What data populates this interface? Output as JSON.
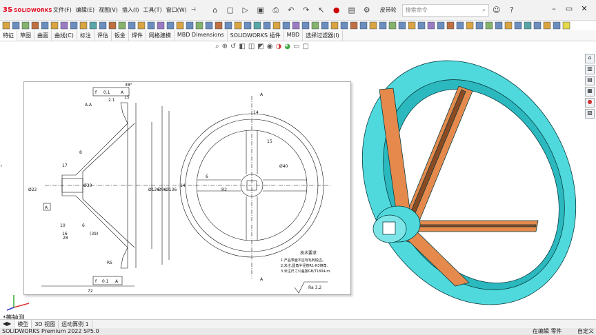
{
  "app": {
    "brand": "SOLIDWORKS",
    "ds_mark": "3S",
    "menus": [
      "文件(F)",
      "编辑(E)",
      "视图(V)",
      "插入(I)",
      "工具(T)",
      "窗口(W)"
    ],
    "pin": "⊣",
    "quick_label": "皮带轮",
    "search_placeholder": "搜索命令"
  },
  "command_tabs": [
    "特征",
    "草图",
    "曲面",
    "曲线(C)",
    "标注",
    "评估",
    "钣金",
    "焊件",
    "网格建模",
    "MBD Dimensions",
    "SOLIDWORKS 插件",
    "MBD",
    "选择过滤器(I)"
  ],
  "drawing": {
    "section_label": "A-A",
    "tolerance_frame": [
      "f",
      "0.1",
      "A"
    ],
    "datum": "A",
    "dims": {
      "d38": "38°",
      "d15": "15",
      "d21": "2.1",
      "d17": "17",
      "d8": "8",
      "d10": "10",
      "d6": "6",
      "d16": "16",
      "d28": "28",
      "d39": "(39)",
      "dR5": "R5",
      "d72": "72",
      "d22": "Ø22",
      "d30": "Ø30",
      "d96": "Ø96",
      "d136": "Ø136",
      "d126": "Ø126",
      "d40": "Ø40",
      "d14": "14",
      "d15b": "15",
      "d6b": "6",
      "d1": "14",
      "dR2": "R2",
      "roughness": "Ra 3.2"
    },
    "notes": [
      "技术要求",
      "1.产品表面不应有毛刺锐边。",
      "2.未注,圆角半径按R1-R3倒角.",
      "3.未注尺寸公差按GB/T1804-m."
    ]
  },
  "view_label": "*等轴测",
  "model_tabs": [
    "模型",
    "3D 视图",
    "运动算例 1"
  ],
  "status": {
    "left": "SOLIDWORKS Premium 2022 SP5.0",
    "editing": "在编辑 零件",
    "custom": "自定义"
  }
}
